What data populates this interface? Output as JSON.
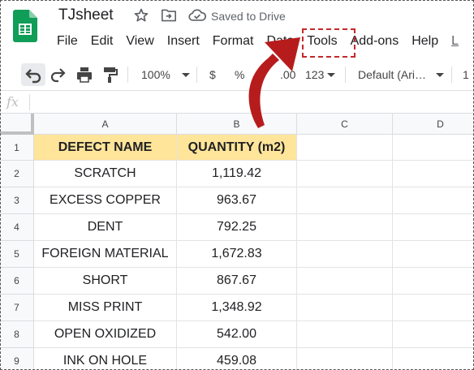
{
  "header": {
    "title": "TJsheet",
    "saved_status": "Saved to Drive"
  },
  "menu": {
    "items": [
      "File",
      "Edit",
      "View",
      "Insert",
      "Format",
      "Data",
      "Tools",
      "Add-ons",
      "Help",
      "L"
    ]
  },
  "toolbar": {
    "zoom": "100%",
    "currency": "$",
    "percent": "%",
    "decimal_decrease": ".0",
    "decimal_increase": ".00",
    "more_formats": "123",
    "font": "Default (Ari…",
    "font_size": "1"
  },
  "formula_bar": {
    "fx": "fx",
    "value": ""
  },
  "columns": [
    "A",
    "B",
    "C",
    "D"
  ],
  "rows": [
    "1",
    "2",
    "3",
    "4",
    "5",
    "6",
    "7",
    "8",
    "9"
  ],
  "table": {
    "headers": [
      "DEFECT NAME",
      "QUANTITY (m2)"
    ],
    "data": [
      [
        "SCRATCH",
        "1,119.42"
      ],
      [
        "EXCESS COPPER",
        "963.67"
      ],
      [
        "DENT",
        "792.25"
      ],
      [
        "FOREIGN MATERIAL",
        "1,672.83"
      ],
      [
        "SHORT",
        "867.67"
      ],
      [
        "MISS PRINT",
        "1,348.92"
      ],
      [
        "OPEN OXIDIZED",
        "542.00"
      ],
      [
        "INK ON HOLE",
        "459.08"
      ]
    ]
  },
  "colors": {
    "header_fill": "#ffe599",
    "annotation": "#c62828",
    "sheets_green": "#0f9d58"
  }
}
